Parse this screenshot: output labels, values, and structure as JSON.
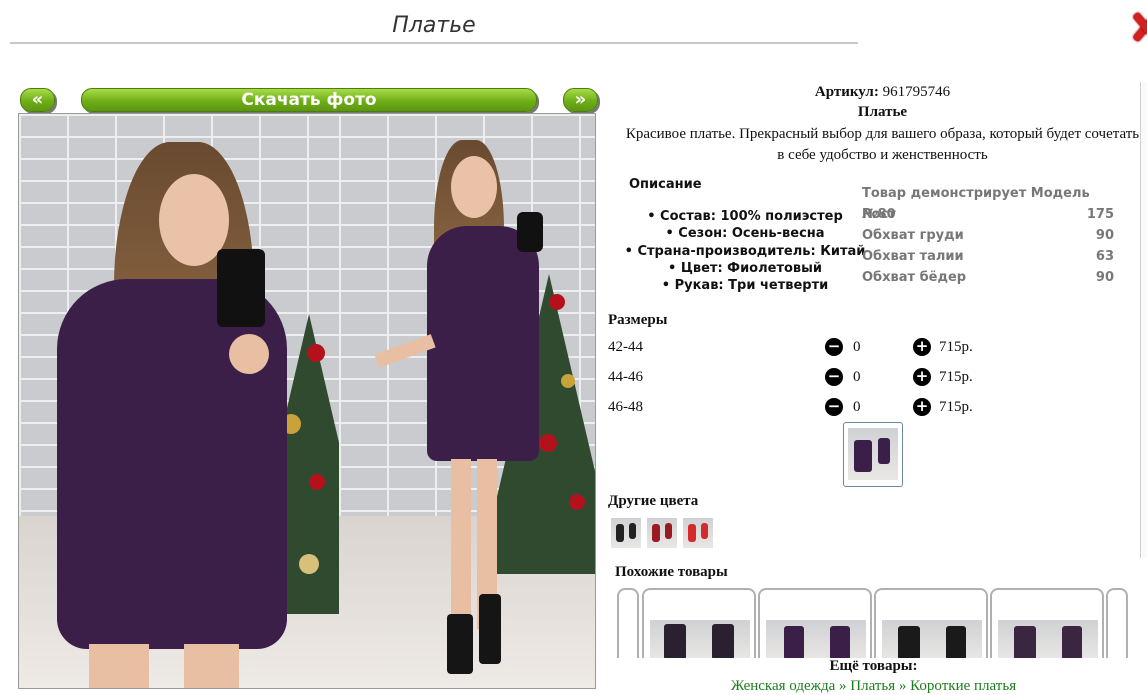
{
  "page": {
    "title": "Платье",
    "colors": {
      "accent_green": "#6fae17",
      "dress_purple": "#3b1f49",
      "close_red": "#d32020",
      "link_green": "#1c7d1c"
    }
  },
  "gallery": {
    "prev_label": "«",
    "download_label": "Скачать фото",
    "next_label": "»"
  },
  "product": {
    "article_label": "Артикул:",
    "article_value": "961795746",
    "name": "Платье",
    "description": "Красивое платье. Прекрасный выбор для вашего образа, который будет сочетать в себе удобство и женственность"
  },
  "specs": {
    "title": "Описание",
    "items": [
      "• Состав: 100% полиэстер",
      "• Сезон: Осень-весна",
      "• Страна-производитель: Китай",
      "• Цвет: Фиолетовый",
      "• Рукав: Три четверти"
    ]
  },
  "model": {
    "header": "Товар демонстрирует Модель №80",
    "rows": [
      {
        "label": "Рост",
        "value": "175"
      },
      {
        "label": "Обхват груди",
        "value": "90"
      },
      {
        "label": "Обхват талии",
        "value": "63"
      },
      {
        "label": "Обхват бёдер",
        "value": "90"
      }
    ]
  },
  "sizes": {
    "title": "Размеры",
    "rows": [
      {
        "size": "42-44",
        "qty": "0",
        "price": "715р."
      },
      {
        "size": "44-46",
        "qty": "0",
        "price": "715р."
      },
      {
        "size": "46-48",
        "qty": "0",
        "price": "715р."
      }
    ]
  },
  "other_colors": {
    "title": "Другие цвета"
  },
  "similar": {
    "title": "Похожие товары"
  },
  "more": {
    "title": "Ещё товары:",
    "links": "Женская одежда » Платья » Короткие платья"
  }
}
